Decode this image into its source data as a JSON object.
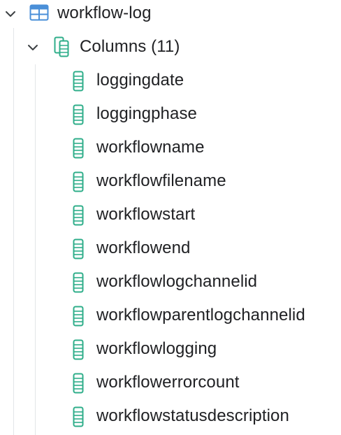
{
  "table_node": {
    "label": "workflow-log",
    "expanded": true,
    "icon": "table-icon",
    "icon_color": "#4a8fd8"
  },
  "columns_node": {
    "label": "Columns (11)",
    "expanded": true,
    "icon": "columns-group-icon",
    "icon_color": "#2fae8a"
  },
  "column_icon": "column-icon",
  "column_icon_color": "#2fae8a",
  "columns": [
    {
      "label": "loggingdate"
    },
    {
      "label": "loggingphase"
    },
    {
      "label": "workflowname"
    },
    {
      "label": "workflowfilename"
    },
    {
      "label": "workflowstart"
    },
    {
      "label": "workflowend"
    },
    {
      "label": "workflowlogchannelid"
    },
    {
      "label": "workflowparentlogchannelid"
    },
    {
      "label": "workflowlogging"
    },
    {
      "label": "workflowerrorcount"
    },
    {
      "label": "workflowstatusdescription"
    }
  ]
}
